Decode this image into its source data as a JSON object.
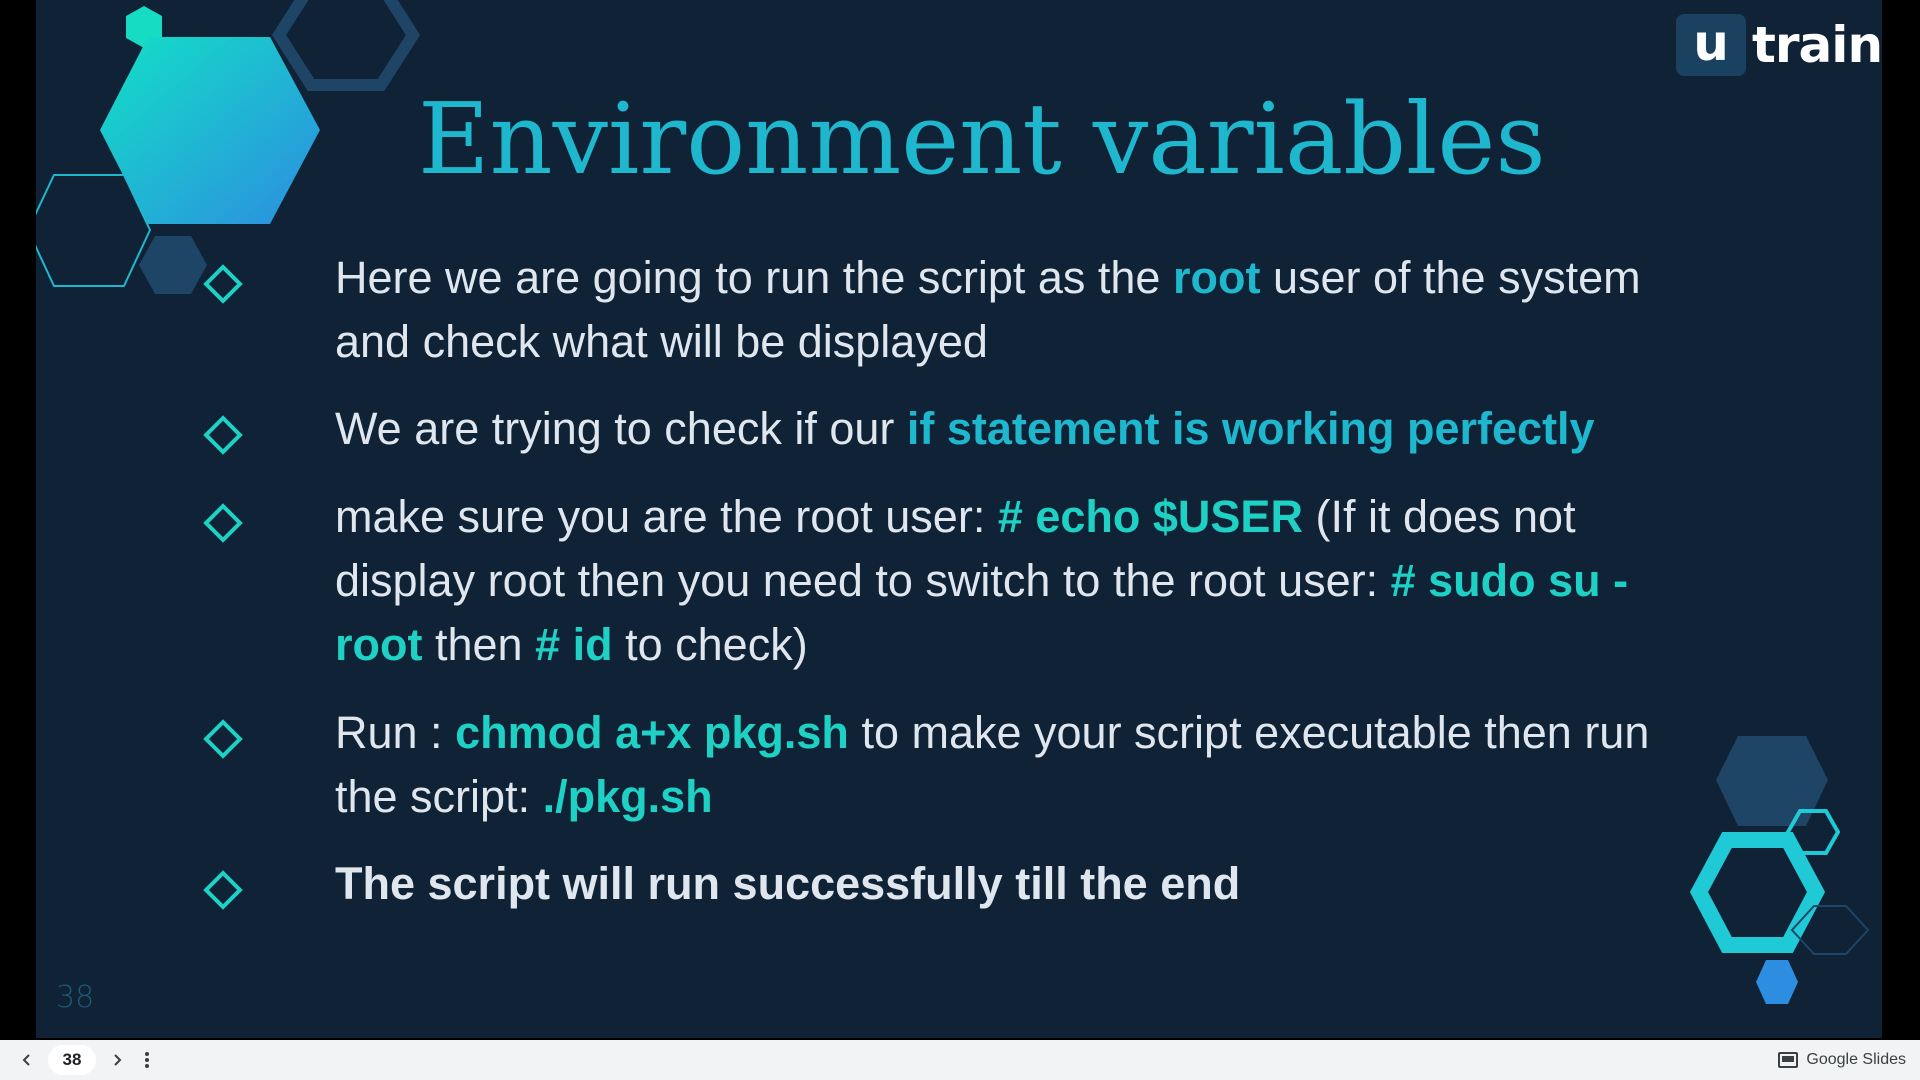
{
  "slide": {
    "title": "Environment variables",
    "page_number": "38",
    "logo": {
      "box_letter": "u",
      "text": "train"
    },
    "bullets": [
      {
        "segments": [
          {
            "text": "Here we are going to run the script as the ",
            "style": "normal"
          },
          {
            "text": "root",
            "style": "hl-blue"
          },
          {
            "text": " user of the system and check what will be displayed",
            "style": "normal"
          }
        ]
      },
      {
        "segments": [
          {
            "text": "We are trying to check if our ",
            "style": "normal"
          },
          {
            "text": "if statement is working perfectly",
            "style": "hl-blue"
          }
        ]
      },
      {
        "segments": [
          {
            "text": "make sure you are the root user: ",
            "style": "normal"
          },
          {
            "text": "# echo $USER",
            "style": "hl-teal"
          },
          {
            "text": "  (If it does not display root then you need to switch to the root user: ",
            "style": "normal"
          },
          {
            "text": "# sudo su - root",
            "style": "hl-teal"
          },
          {
            "text": "  then ",
            "style": "normal"
          },
          {
            "text": "# id",
            "style": "hl-teal"
          },
          {
            "text": " to check)",
            "style": "normal"
          }
        ]
      },
      {
        "segments": [
          {
            "text": "Run : ",
            "style": "normal"
          },
          {
            "text": "chmod a+x pkg.sh",
            "style": "hl-teal"
          },
          {
            "text": " to make your script executable then run the script: ",
            "style": "normal"
          },
          {
            "text": "./pkg.sh",
            "style": "hl-teal"
          }
        ]
      },
      {
        "segments": [
          {
            "text": "The script will run successfully till the end",
            "style": "bold-white"
          }
        ]
      }
    ],
    "colors": {
      "background": "#0f2236",
      "accent_blue": "#1fb7ce",
      "accent_teal": "#1fd1c4",
      "body_text": "#dfe6ee"
    }
  },
  "toolbar": {
    "prev_icon": "chevron-left-icon",
    "current_page": "38",
    "next_icon": "chevron-right-icon",
    "more_icon": "more-vertical-icon",
    "brand_label": "Google Slides"
  }
}
